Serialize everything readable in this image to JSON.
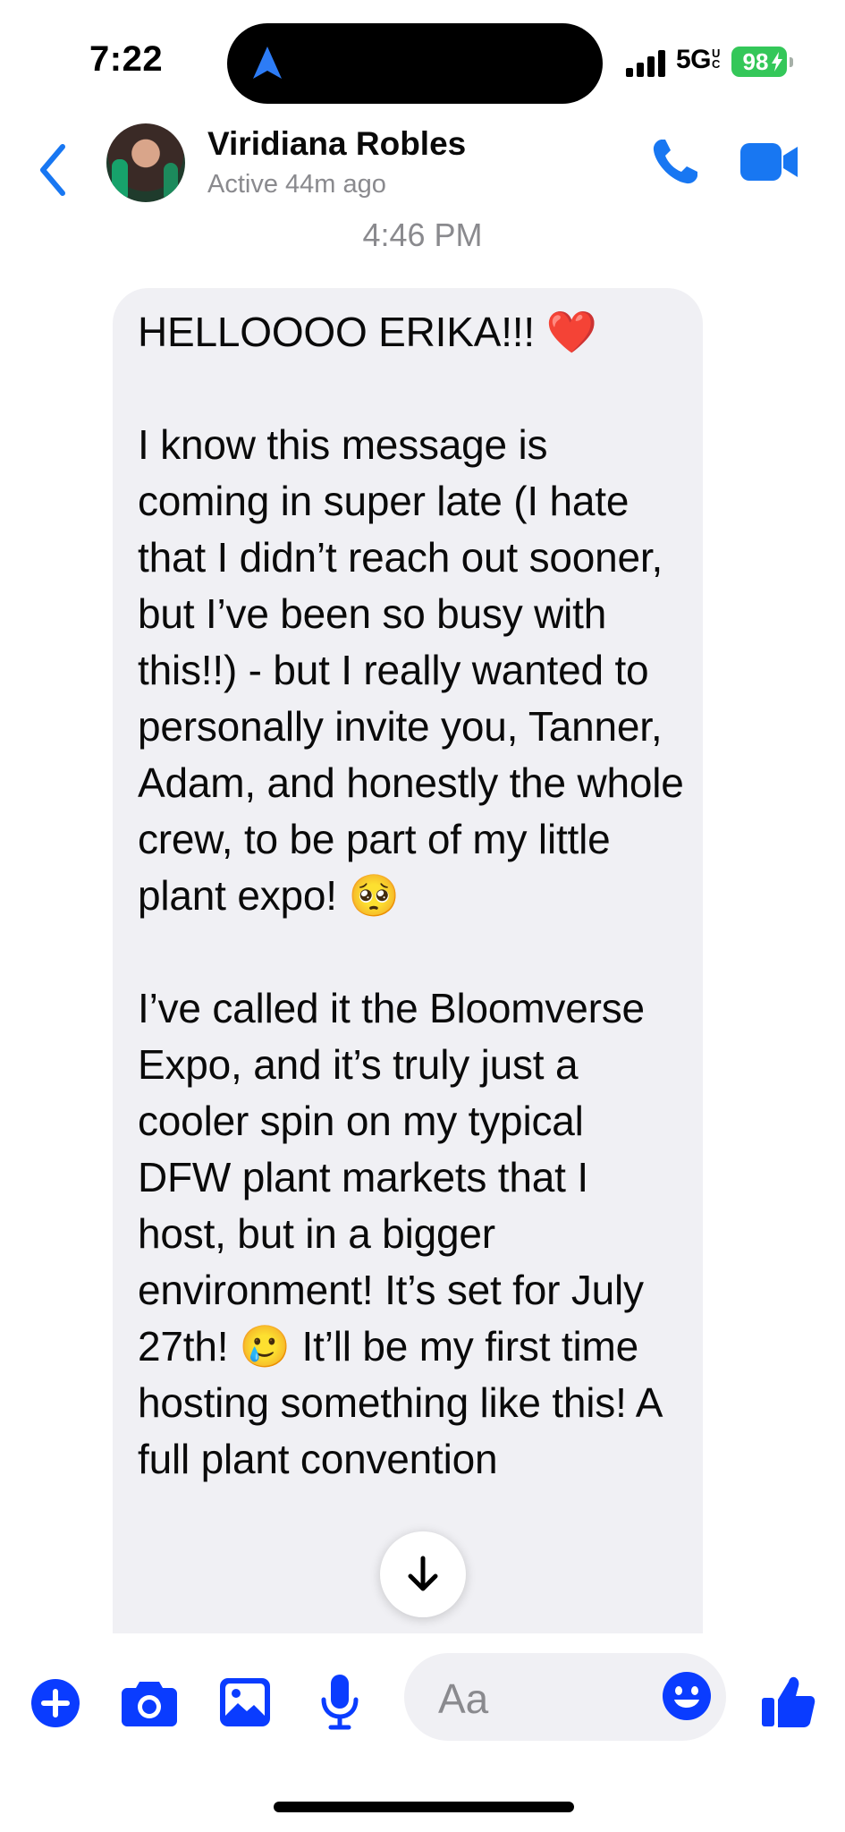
{
  "status_bar": {
    "time": "7:22",
    "network": "5G",
    "network_badge": "UC",
    "battery": "98"
  },
  "header": {
    "contact_name": "Viridiana Robles",
    "contact_status": "Active 44m ago"
  },
  "conversation": {
    "timestamp": "4:46 PM",
    "message": "HELLOOOO ERIKA!!! ❤️\n\nI know this message is coming in super late (I hate that I didn’t reach out sooner, but I’ve been so busy with this!!) - but I really wanted to personally invite you, Tanner, Adam, and honestly the whole crew, to be part of my little plant expo! 🥺\n\nI’ve called it the Bloomverse Expo, and it’s truly just a cooler spin on my typical DFW plant markets that I host, but in a bigger environment! It’s set for July 27th! 🥲 It’ll be my first time hosting something like this! A full plant convention"
  },
  "composer": {
    "placeholder": "Aa"
  },
  "colors": {
    "accent": "#1877f2",
    "composer_icon": "#0a3cff",
    "bubble": "#f0f0f4",
    "secondary_text": "#8a8a8e",
    "battery": "#34c759"
  },
  "icons": {
    "back": "chevron-left-icon",
    "call": "phone-icon",
    "video": "video-camera-icon",
    "scroll": "arrow-down-icon",
    "plus": "plus-circle-icon",
    "camera": "camera-icon",
    "photo": "photo-icon",
    "mic": "microphone-icon",
    "emoji": "emoji-icon",
    "like": "thumbs-up-icon"
  }
}
